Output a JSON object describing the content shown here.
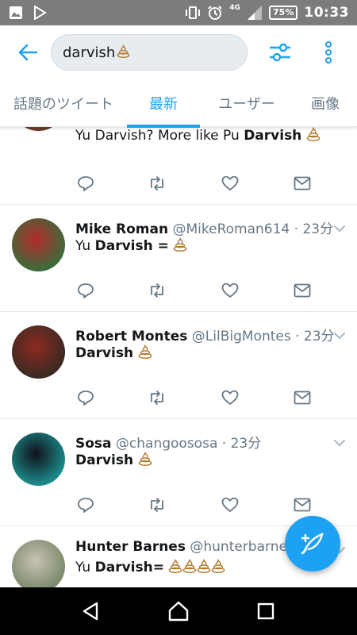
{
  "status_bar": {
    "network": "4G",
    "battery": "75%",
    "time": "10:33",
    "icons": [
      "image-icon",
      "play-store-icon",
      "vibrate-icon",
      "alarm-icon",
      "signal-icon"
    ]
  },
  "search": {
    "query": "darvish"
  },
  "tabs": [
    {
      "label": "話題のツイート",
      "active": false
    },
    {
      "label": "最新",
      "active": true
    },
    {
      "label": "ユーザー",
      "active": false
    },
    {
      "label": "画像",
      "active": false
    }
  ],
  "tweets": [
    {
      "name": "",
      "handle": "",
      "time": "",
      "text_before": "Yu Darvish? More like Pu ",
      "text_bold": "Darvish",
      "text_after": "",
      "poo_count": 1,
      "avatar_colors": [
        "#6b3a2b",
        "#c9a07a"
      ]
    },
    {
      "name": "Mike Roman",
      "handle": "@MikeRoman614",
      "time": "23分",
      "text_before": "Yu ",
      "text_bold": "Darvish =",
      "text_after": " ",
      "poo_count": 1,
      "avatar_colors": [
        "#3d6b3a",
        "#b52a2a"
      ]
    },
    {
      "name": "Robert Montes",
      "handle": "@LilBigMontes",
      "time": "23分",
      "text_before": "",
      "text_bold": "Darvish",
      "text_after": " ",
      "poo_count": 1,
      "avatar_colors": [
        "#3a2a22",
        "#8f2a20"
      ]
    },
    {
      "name": "Sosa",
      "handle": "@changoososa",
      "time": "23分",
      "text_before": "",
      "text_bold": "Darvish",
      "text_after": " ",
      "poo_count": 1,
      "avatar_colors": [
        "#1c8a8a",
        "#101018"
      ]
    },
    {
      "name": "Hunter Barnes",
      "handle": "@hunterbarne…",
      "time": "",
      "text_before": "Yu ",
      "text_bold": "Darvish=",
      "text_after": " ",
      "poo_count": 4,
      "avatar_colors": [
        "#7a8a6a",
        "#c9c2b5"
      ]
    }
  ],
  "colors": {
    "accent": "#1da1f2",
    "muted": "#657786",
    "text": "#14171a",
    "divider": "#e1e8ed"
  }
}
